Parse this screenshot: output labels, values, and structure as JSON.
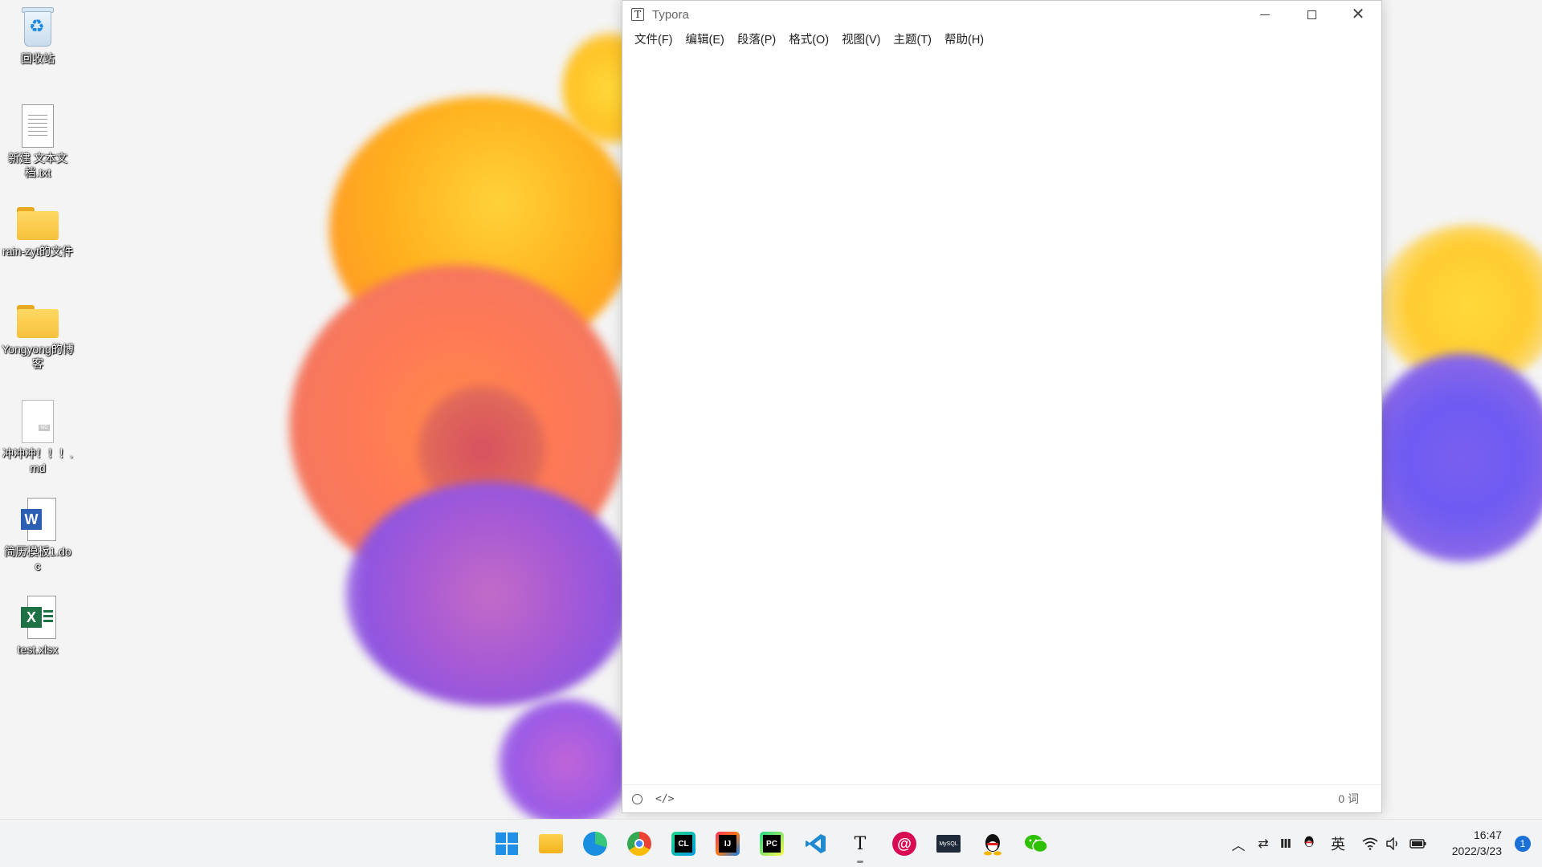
{
  "desktop": {
    "icons": [
      {
        "label": "回收站",
        "icon": "recycle-bin-icon"
      },
      {
        "label": "新建 文本文档.txt",
        "icon": "text-file-icon"
      },
      {
        "label": "rain-zyt的文件",
        "icon": "folder-icon"
      },
      {
        "label": "Yongyong的博客",
        "icon": "folder-icon"
      },
      {
        "label": "冲冲冲！！！.md",
        "icon": "markdown-file-icon"
      },
      {
        "label": "简历模板1.doc",
        "icon": "word-document-icon"
      },
      {
        "label": "test.xlsx",
        "icon": "excel-spreadsheet-icon"
      }
    ]
  },
  "window": {
    "app_icon_glyph": "T",
    "title": "Typora",
    "menu": [
      "文件(F)",
      "编辑(E)",
      "段落(P)",
      "格式(O)",
      "视图(V)",
      "主题(T)",
      "帮助(H)"
    ],
    "status": {
      "code_glyph": "</>",
      "word_count": "0 词"
    }
  },
  "taskbar": {
    "apps": [
      {
        "name": "start",
        "icon": "windows-start-icon"
      },
      {
        "name": "file-explorer",
        "icon": "folder-icon"
      },
      {
        "name": "edge",
        "icon": "edge-browser-icon"
      },
      {
        "name": "chrome",
        "icon": "chrome-browser-icon"
      },
      {
        "name": "clion",
        "icon": "clion-icon",
        "text": "CL"
      },
      {
        "name": "intellij",
        "icon": "intellij-icon",
        "text": "IJ"
      },
      {
        "name": "pycharm",
        "icon": "pycharm-icon",
        "text": "PC"
      },
      {
        "name": "vscode",
        "icon": "vscode-icon"
      },
      {
        "name": "typora",
        "icon": "typora-icon",
        "text": "T"
      },
      {
        "name": "debian",
        "icon": "debian-icon"
      },
      {
        "name": "mysql",
        "icon": "mysql-terminal-icon",
        "text": "MySQL"
      },
      {
        "name": "qq",
        "icon": "qq-icon"
      },
      {
        "name": "wechat",
        "icon": "wechat-icon"
      }
    ],
    "tray": {
      "ime": "英",
      "time": "16:47",
      "date": "2022/3/23",
      "notifications": "1"
    }
  },
  "colors": {
    "accent": "#1a6fd8",
    "window_bg": "#ffffff"
  }
}
